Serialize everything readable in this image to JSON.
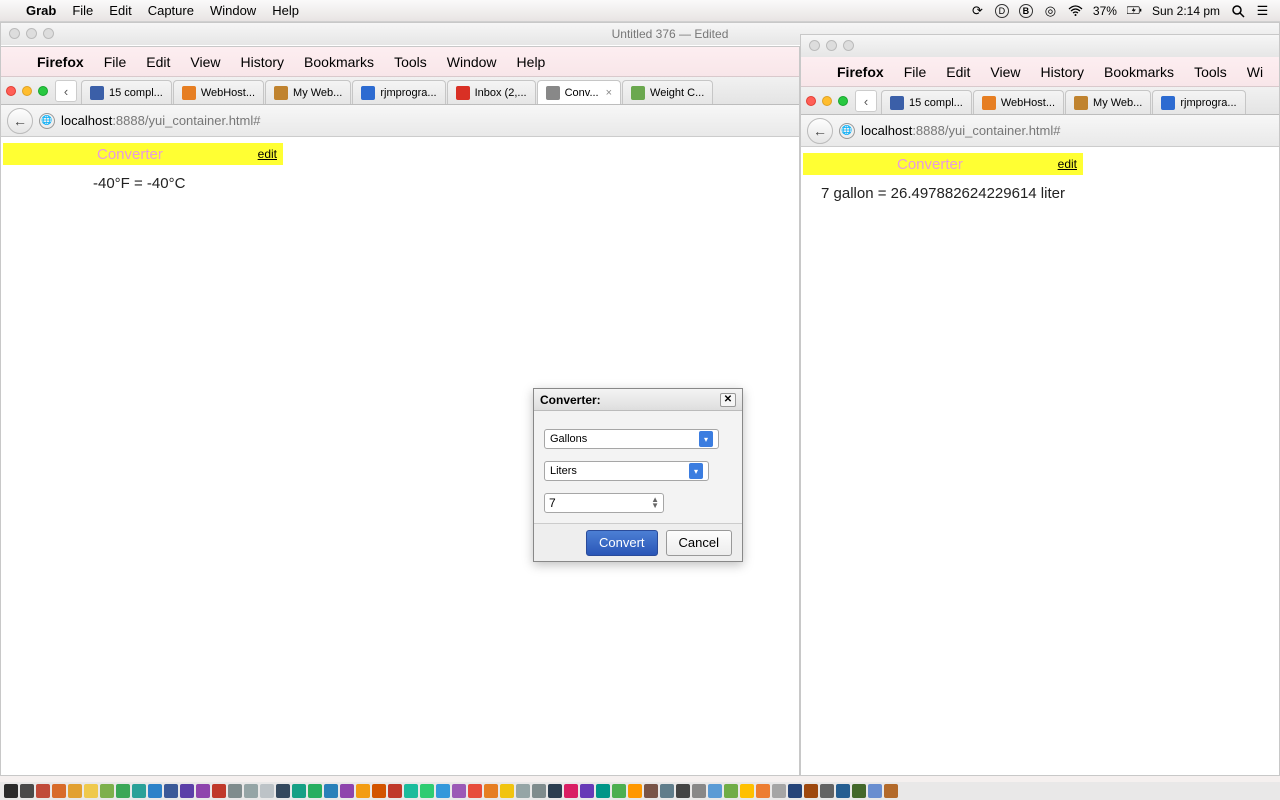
{
  "menubar": {
    "app": "Grab",
    "items": [
      "File",
      "Edit",
      "Capture",
      "Window",
      "Help"
    ],
    "battery": "37%",
    "time": "Sun 2:14 pm"
  },
  "grabwin": {
    "title": "Untitled 376  —  Edited"
  },
  "firefox": {
    "app": "Firefox",
    "items": [
      "File",
      "Edit",
      "View",
      "History",
      "Bookmarks",
      "Tools",
      "Window",
      "Help"
    ]
  },
  "tabs": [
    {
      "label": "15 compl...",
      "color": "#3b5fa8"
    },
    {
      "label": "WebHost...",
      "color": "#e67e22"
    },
    {
      "label": "My Web...",
      "color": "#c0832f"
    },
    {
      "label": "rjmprogra...",
      "color": "#2d6bd1"
    },
    {
      "label": "Inbox (2,...",
      "color": "#d93025"
    },
    {
      "label": "Conv...",
      "color": "#888",
      "active": true
    },
    {
      "label": "Weight C...",
      "color": "#6ba84f"
    }
  ],
  "tabs2": [
    {
      "label": "15 compl...",
      "color": "#3b5fa8"
    },
    {
      "label": "WebHost...",
      "color": "#e67e22"
    },
    {
      "label": "My Web...",
      "color": "#c0832f"
    },
    {
      "label": "rjmprogra...",
      "color": "#2d6bd1"
    }
  ],
  "url": {
    "host": "localhost",
    "port": ":8888",
    "path": "/yui_container.html#"
  },
  "page1": {
    "title": "Converter",
    "edit": "edit",
    "result": "-40°F = -40°C"
  },
  "page2": {
    "title": "Converter",
    "edit": "edit",
    "result": "7 gallon = 26.497882624229614 liter"
  },
  "dialog": {
    "title": "Converter:",
    "sel1": "Gallons",
    "sel2": "Liters",
    "value": "7",
    "convert": "Convert",
    "cancel": "Cancel"
  },
  "dockColors": [
    "#2b2b2b",
    "#4a4a4a",
    "#c14b3a",
    "#d86b2a",
    "#e2a030",
    "#efc94c",
    "#7db04b",
    "#3aa757",
    "#2aa198",
    "#2c82c9",
    "#3b5998",
    "#5b3fa8",
    "#8e44ad",
    "#c0392b",
    "#7f8c8d",
    "#95a5a6",
    "#bdc3c7",
    "#34495e",
    "#16a085",
    "#27ae60",
    "#2980b9",
    "#8e44ad",
    "#f39c12",
    "#d35400",
    "#c0392b",
    "#1abc9c",
    "#2ecc71",
    "#3498db",
    "#9b59b6",
    "#e74c3c",
    "#e67e22",
    "#f1c40f",
    "#95a5a6",
    "#7f8c8d",
    "#2c3e50",
    "#d91e63",
    "#673ab7",
    "#009688",
    "#4caf50",
    "#ff9800",
    "#795548",
    "#607d8b",
    "#444",
    "#888",
    "#5b9bd5",
    "#70ad47",
    "#ffc000",
    "#ed7d31",
    "#a5a5a5",
    "#264478",
    "#9e480e",
    "#636363",
    "#255e91",
    "#43682b",
    "#698ed0",
    "#b36a2b"
  ]
}
